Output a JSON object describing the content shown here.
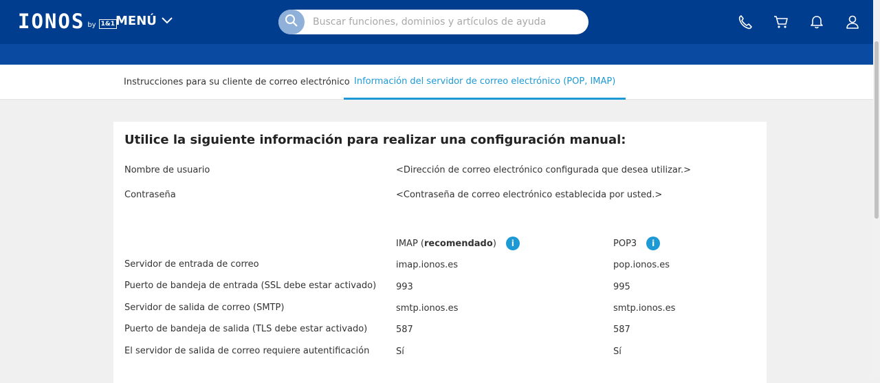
{
  "header": {
    "logo_text": "IONOS",
    "logo_by": "by",
    "logo_badge": "1&1",
    "menu_label": "MENÚ",
    "search_placeholder": "Buscar funciones, dominios y artículos de ayuda"
  },
  "colors": {
    "header_bg": "#003d8f",
    "accent": "#1d9ad6"
  },
  "tabs": [
    {
      "label": "Instrucciones para su cliente de correo electrónico",
      "active": false
    },
    {
      "label": "Información del servidor de correo electrónico (POP, IMAP)",
      "active": true
    }
  ],
  "card": {
    "title": "Utilice la siguiente información para realizar una configuración manual:",
    "credentials": [
      {
        "label": "Nombre de usuario",
        "value": "<Dirección de correo electrónico configurada que desea utilizar.>"
      },
      {
        "label": "Contraseña",
        "value": "<Contraseña de correo electrónico establecida por usted.>"
      }
    ],
    "columns": {
      "imap_prefix": "IMAP (",
      "imap_strong": "recomendado",
      "imap_suffix": ")",
      "pop3": "POP3"
    },
    "rows": [
      {
        "label": "Servidor de entrada de correo",
        "imap": "imap.ionos.es",
        "pop3": "pop.ionos.es"
      },
      {
        "label": "Puerto de bandeja de entrada (SSL debe estar activado)",
        "imap": "993",
        "pop3": "995"
      },
      {
        "label": "Servidor de salida de correo (SMTP)",
        "imap": "smtp.ionos.es",
        "pop3": "smtp.ionos.es"
      },
      {
        "label": "Puerto de bandeja de salida (TLS debe estar activado)",
        "imap": "587",
        "pop3": "587"
      },
      {
        "label": "El servidor de salida de correo requiere autentificación",
        "imap": "Sí",
        "pop3": "Sí"
      }
    ]
  }
}
